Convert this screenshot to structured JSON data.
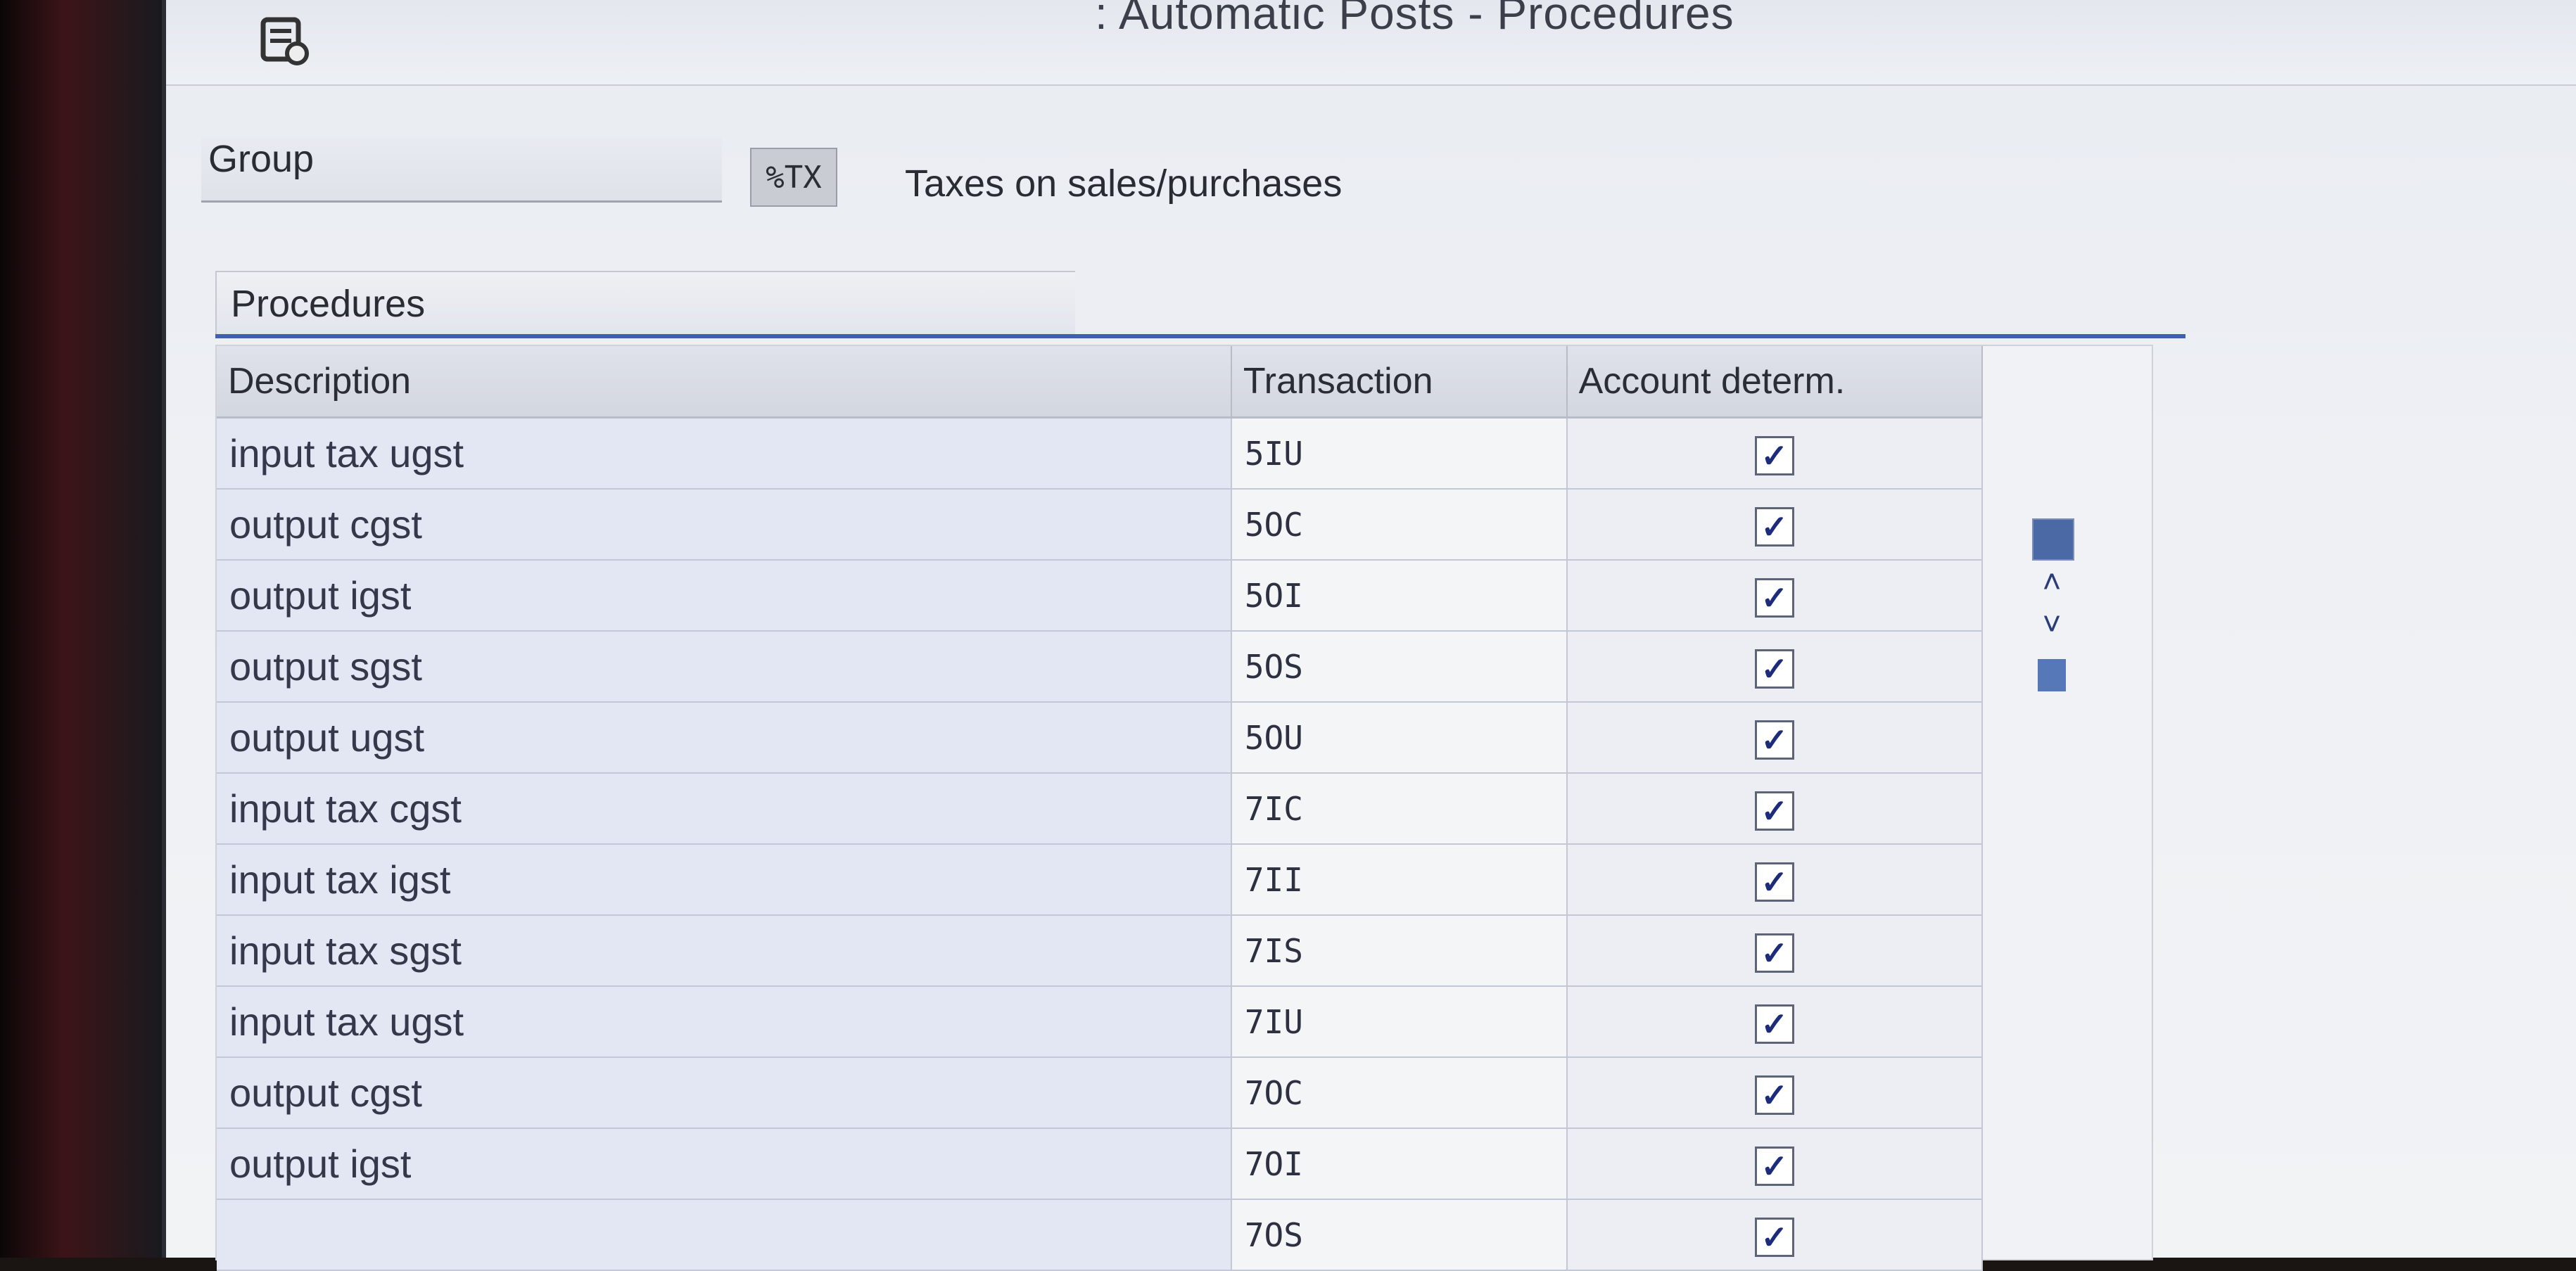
{
  "window": {
    "title": ": Automatic Posts - Procedures"
  },
  "group": {
    "label": "Group",
    "value": "%TX",
    "description": "Taxes on sales/purchases"
  },
  "panel": {
    "tab_label": "Procedures"
  },
  "table": {
    "columns": [
      "Description",
      "Transaction",
      "Account determ."
    ],
    "rows": [
      {
        "description": "input tax ugst",
        "transaction": "5IU",
        "account_determ": true
      },
      {
        "description": "output cgst",
        "transaction": "5OC",
        "account_determ": true
      },
      {
        "description": "output igst",
        "transaction": "5OI",
        "account_determ": true
      },
      {
        "description": "output sgst",
        "transaction": "5OS",
        "account_determ": true
      },
      {
        "description": "output ugst",
        "transaction": "5OU",
        "account_determ": true
      },
      {
        "description": "input tax cgst",
        "transaction": "7IC",
        "account_determ": true
      },
      {
        "description": "input tax igst",
        "transaction": "7II",
        "account_determ": true
      },
      {
        "description": "input tax sgst",
        "transaction": "7IS",
        "account_determ": true
      },
      {
        "description": "input tax ugst",
        "transaction": "7IU",
        "account_determ": true
      },
      {
        "description": "output cgst",
        "transaction": "7OC",
        "account_determ": true
      },
      {
        "description": "output igst",
        "transaction": "7OI",
        "account_determ": true
      },
      {
        "description": "",
        "transaction": "7OS",
        "account_determ": true
      }
    ]
  },
  "icons": {
    "app_icon": "settings-list-icon",
    "check": "✓",
    "scroll_up": "˄",
    "scroll_down": "˅"
  }
}
